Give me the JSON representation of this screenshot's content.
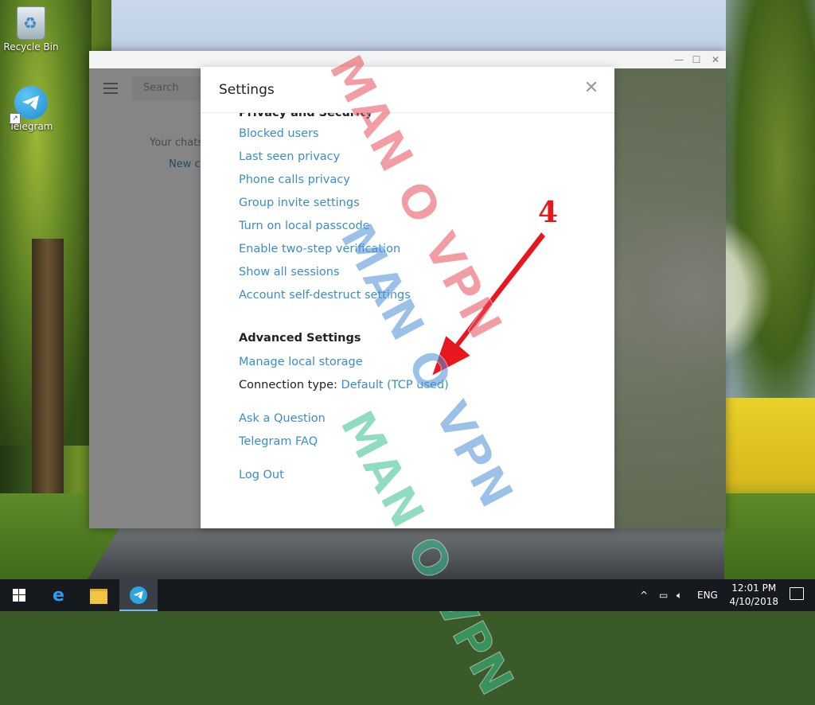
{
  "desktop": {
    "icons": [
      {
        "label": "Recycle Bin"
      },
      {
        "label": "Telegram"
      }
    ]
  },
  "telegram_window": {
    "sidebar": {
      "search_placeholder": "Search",
      "empty_text": "Your chats",
      "new_contact": "New co"
    }
  },
  "settings": {
    "title": "Settings",
    "privacy_section_cut": "Privacy and Security",
    "privacy_links": [
      "Blocked users",
      "Last seen privacy",
      "Phone calls privacy",
      "Group invite settings",
      "Turn on local passcode",
      "Enable two-step verification",
      "Show all sessions",
      "Account self-destruct settings"
    ],
    "advanced_title": "Advanced Settings",
    "manage_storage": "Manage local storage",
    "connection_label": "Connection type: ",
    "connection_value": "Default (TCP used)",
    "ask_question": "Ask a Question",
    "faq": "Telegram FAQ",
    "logout": "Log Out"
  },
  "annotation": {
    "step_number": "4",
    "arrow_color": "#e8171f"
  },
  "watermarks": [
    {
      "text": "MAN O VPN",
      "color": "#e84c5a"
    },
    {
      "text": "MAN O VPN",
      "color": "#4a8fd8"
    },
    {
      "text": "MAN O VPN",
      "color": "#35c08a"
    }
  ],
  "taskbar": {
    "language": "ENG",
    "time": "12:01 PM",
    "date": "4/10/2018",
    "active_app": "Telegram"
  },
  "colors": {
    "link": "#3a8dc8",
    "taskbar": "#161a1f"
  }
}
